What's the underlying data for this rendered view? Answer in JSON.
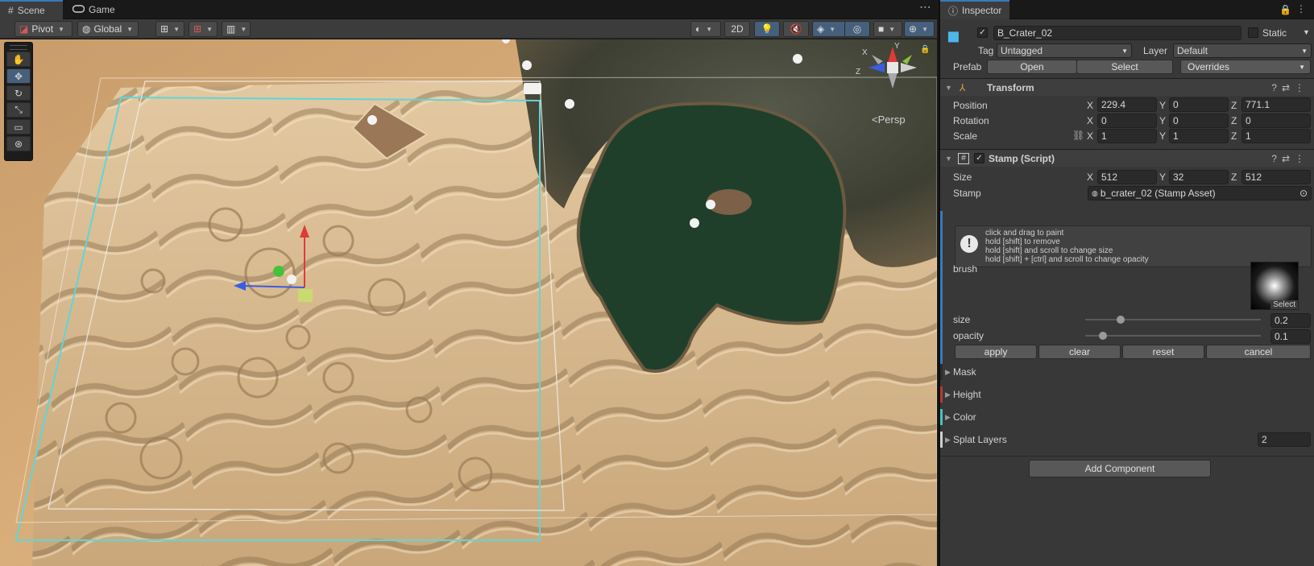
{
  "scene": {
    "tabs": [
      {
        "label": "Scene",
        "icon": "grid-hash-icon"
      },
      {
        "label": "Game",
        "icon": "gamepad-icon"
      }
    ],
    "toolbar": {
      "pivot": "Pivot",
      "global": "Global",
      "mode_2d": "2D"
    },
    "gizmo": {
      "persp_label": "<Persp",
      "y": "Y",
      "x": "X",
      "z": "Z"
    }
  },
  "inspector": {
    "tab_label": "Inspector",
    "object": {
      "name": "B_Crater_02",
      "static_label": "Static",
      "tag_label": "Tag",
      "tag_value": "Untagged",
      "layer_label": "Layer",
      "layer_value": "Default",
      "prefab_label": "Prefab",
      "open_label": "Open",
      "select_label": "Select",
      "overrides_label": "Overrides"
    },
    "transform": {
      "title": "Transform",
      "position_label": "Position",
      "rotation_label": "Rotation",
      "scale_label": "Scale",
      "position": {
        "x": "229.4",
        "y": "0",
        "z": "771.1"
      },
      "rotation": {
        "x": "0",
        "y": "0",
        "z": "0"
      },
      "scale": {
        "x": "1",
        "y": "1",
        "z": "1"
      }
    },
    "stamp_script": {
      "title": "Stamp (Script)",
      "size_label": "Size",
      "size": {
        "x": "512",
        "y": "32",
        "z": "512"
      },
      "stamp_label": "Stamp",
      "stamp_value": "b_crater_02 (Stamp Asset)",
      "help_lines": [
        "click and drag to paint",
        "hold [shift] to remove",
        "hold [shift] and scroll to change size",
        "hold [shift] + [ctrl] and scroll to change opacity"
      ],
      "brush_label": "brush",
      "brush_select": "Select",
      "size_slider_label": "size",
      "size_slider_value": "0.2",
      "size_slider_fraction": 0.2,
      "opacity_label": "opacity",
      "opacity_value": "0.1",
      "opacity_fraction": 0.1,
      "apply": "apply",
      "clear": "clear",
      "reset": "reset",
      "cancel": "cancel"
    },
    "sections": [
      {
        "label": "Mask",
        "color": "#3a3a3a"
      },
      {
        "label": "Height",
        "color": "#b83a3a"
      },
      {
        "label": "Color",
        "color": "#45c3c8"
      },
      {
        "label": "Splat Layers",
        "color": "#d0d0d0",
        "value": "2"
      }
    ],
    "add_component": "Add Component"
  },
  "colors": {
    "accent": "#3a79bb",
    "water": "#1f3f2b",
    "sand": "#c9a878",
    "bounds_cyan": "#5fd6d8"
  }
}
